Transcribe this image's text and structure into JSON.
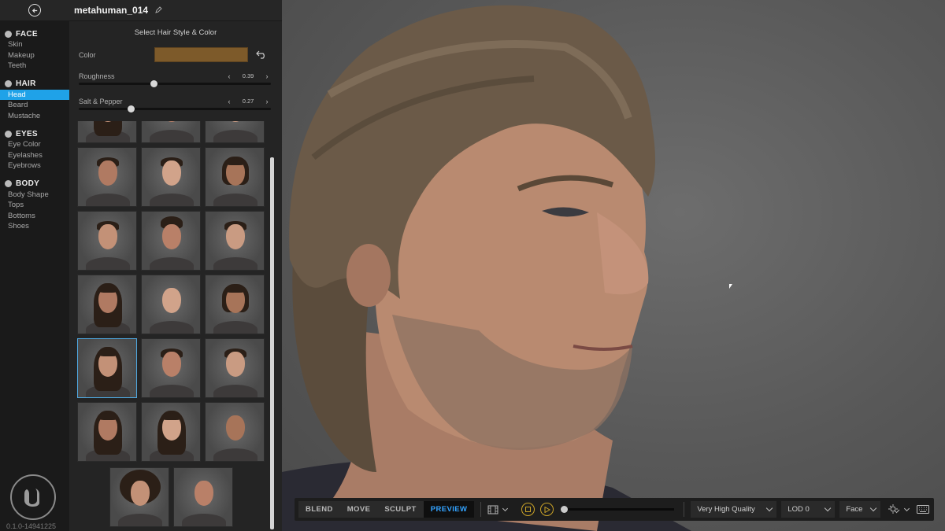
{
  "window": {
    "title": "metahuman_014"
  },
  "nav": {
    "sections": [
      {
        "label": "FACE",
        "items": [
          "Skin",
          "Makeup",
          "Teeth"
        ]
      },
      {
        "label": "HAIR",
        "items": [
          "Head",
          "Beard",
          "Mustache"
        ]
      },
      {
        "label": "EYES",
        "items": [
          "Eye Color",
          "Eyelashes",
          "Eyebrows"
        ]
      },
      {
        "label": "BODY",
        "items": [
          "Body Shape",
          "Tops",
          "Bottoms",
          "Shoes"
        ]
      }
    ],
    "active_item": "Head",
    "version": "0.1.0-14941225"
  },
  "panel": {
    "title": "Select Hair Style & Color",
    "color": {
      "label": "Color",
      "value": "#7d5a2a"
    },
    "roughness": {
      "label": "Roughness",
      "value": "0.39",
      "fraction": 0.39
    },
    "salt_pepper": {
      "label": "Salt & Pepper",
      "value": "0.27",
      "fraction": 0.27
    },
    "selected_thumbnail_index": 12
  },
  "toolbar": {
    "tabs": [
      "BLEND",
      "MOVE",
      "SCULPT",
      "PREVIEW"
    ],
    "active_tab": "PREVIEW",
    "quality": "Very High Quality",
    "lod": "LOD 0",
    "camera": "Face"
  },
  "colors": {
    "accent": "#1fa2e8",
    "preview_tab": "#33a3ff",
    "playback_button": "#c9a227"
  }
}
